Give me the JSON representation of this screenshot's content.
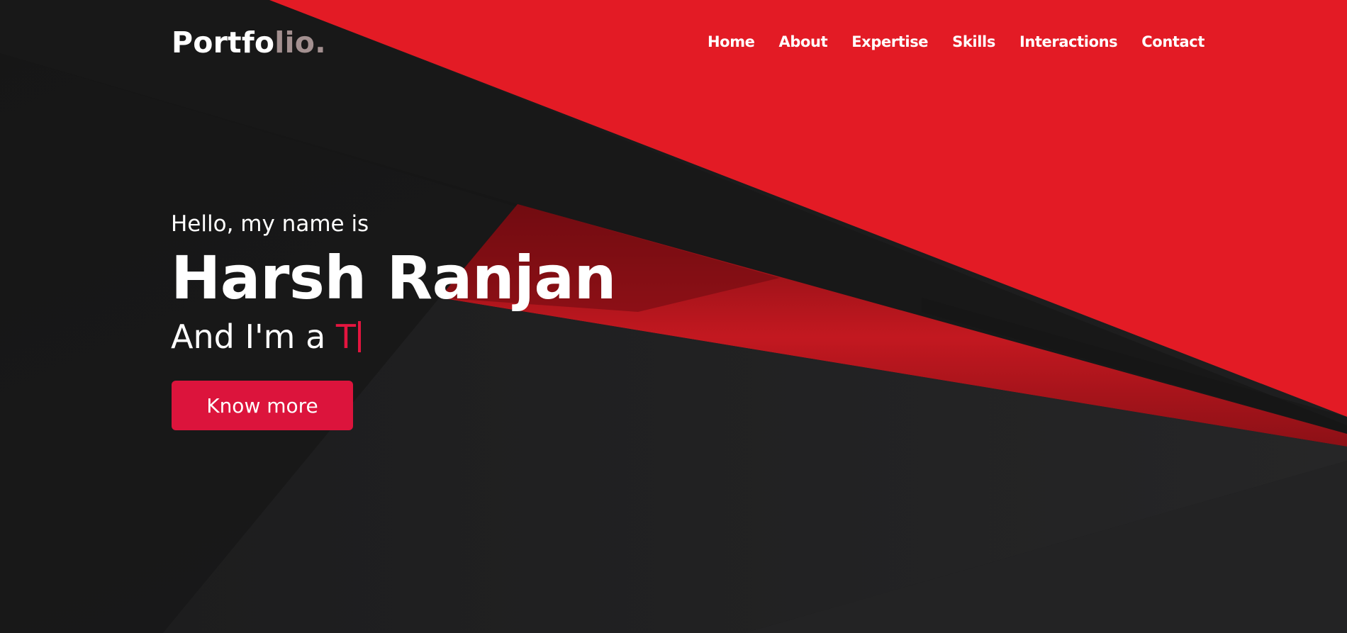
{
  "nav": {
    "logo_text": "Portfo",
    "logo_accent": "lio.",
    "links": [
      "Home",
      "About",
      "Expertise",
      "Skills",
      "Interactions",
      "Contact"
    ]
  },
  "hero": {
    "greeting": "Hello, my name is",
    "name": "Harsh Ranjan",
    "role_prefix": "And I'm a ",
    "typed_text": "T",
    "cta_label": "Know more"
  },
  "colors": {
    "brand_red": "#e31b25",
    "accent_crimson": "#dc143c",
    "background_dark": "#1c1c1d",
    "logo_accent": "#a39090"
  }
}
